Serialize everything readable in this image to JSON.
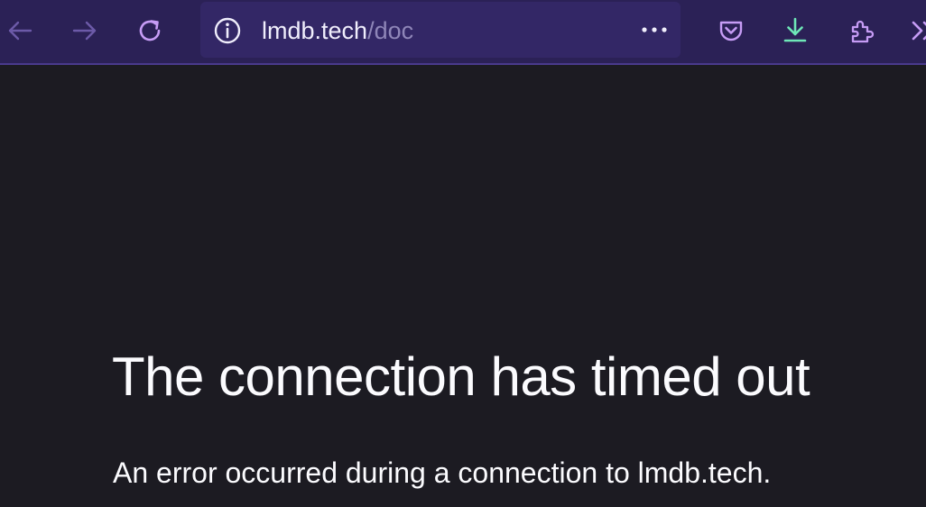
{
  "browser": {
    "url_host": "lmdb.tech",
    "url_path": "/doc",
    "icons": [
      "back-arrow-icon",
      "forward-arrow-icon",
      "reload-icon",
      "info-icon",
      "more-icon",
      "pocket-icon",
      "download-icon",
      "extensions-icon",
      "overflow-chevron-icon"
    ],
    "colors": {
      "toolbar_bg": "#2b2156",
      "urlbar_bg": "#332766",
      "accent": "#c69cf5",
      "download_accent": "#6ee7b7",
      "content_bg": "#1c1b22"
    }
  },
  "error_page": {
    "title": "The connection has timed out",
    "description": "An error occurred during a connection to lmdb.tech."
  }
}
